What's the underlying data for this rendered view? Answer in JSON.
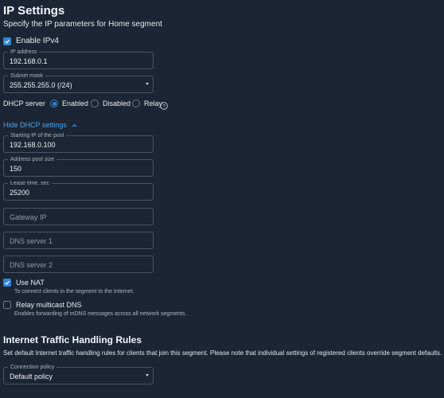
{
  "ip_settings": {
    "title": "IP Settings",
    "subtitle": "Specify the IP parameters for Home segment",
    "enable_ipv4_label": "Enable IPv4",
    "enable_ipv4_checked": true,
    "ip_address": {
      "label": "IP address",
      "value": "192.168.0.1"
    },
    "subnet_mask": {
      "label": "Subnet mask",
      "value": "255.255.255.0 (/24)"
    },
    "dhcp_server": {
      "label": "DHCP server",
      "options": [
        "Enabled",
        "Disabled",
        "Relay"
      ],
      "selected": "Enabled",
      "help_icon": "question-circle-icon"
    }
  },
  "dhcp": {
    "toggle_label": "Hide DHCP settings",
    "pool_start": {
      "label": "Starting IP of the pool",
      "value": "192.168.0.100"
    },
    "pool_size": {
      "label": "Address pool size",
      "value": "150"
    },
    "lease_time": {
      "label": "Lease time, sec",
      "value": "25200"
    },
    "gateway_ip": {
      "placeholder": "Gateway IP"
    },
    "dns1": {
      "placeholder": "DNS server 1"
    },
    "dns2": {
      "placeholder": "DNS server 2"
    }
  },
  "nat": {
    "label": "Use NAT",
    "checked": true,
    "description": "To connect clients in the segment to the Internet."
  },
  "mdns": {
    "label": "Relay multicast DNS",
    "checked": false,
    "description": "Enables forwarding of mDNS messages across all network segments."
  },
  "internet_rules": {
    "title": "Internet Traffic Handling Rules",
    "description": "Set default Internet traffic handling rules for clients that join this segment. Please note that individual settings of registered clients override segment defaults.",
    "connection_policy": {
      "label": "Connection policy",
      "value": "Default policy"
    }
  },
  "colors": {
    "background": "#1b2533",
    "accent": "#2f86d8",
    "link": "#4ea3ee",
    "border": "#4a5666"
  }
}
